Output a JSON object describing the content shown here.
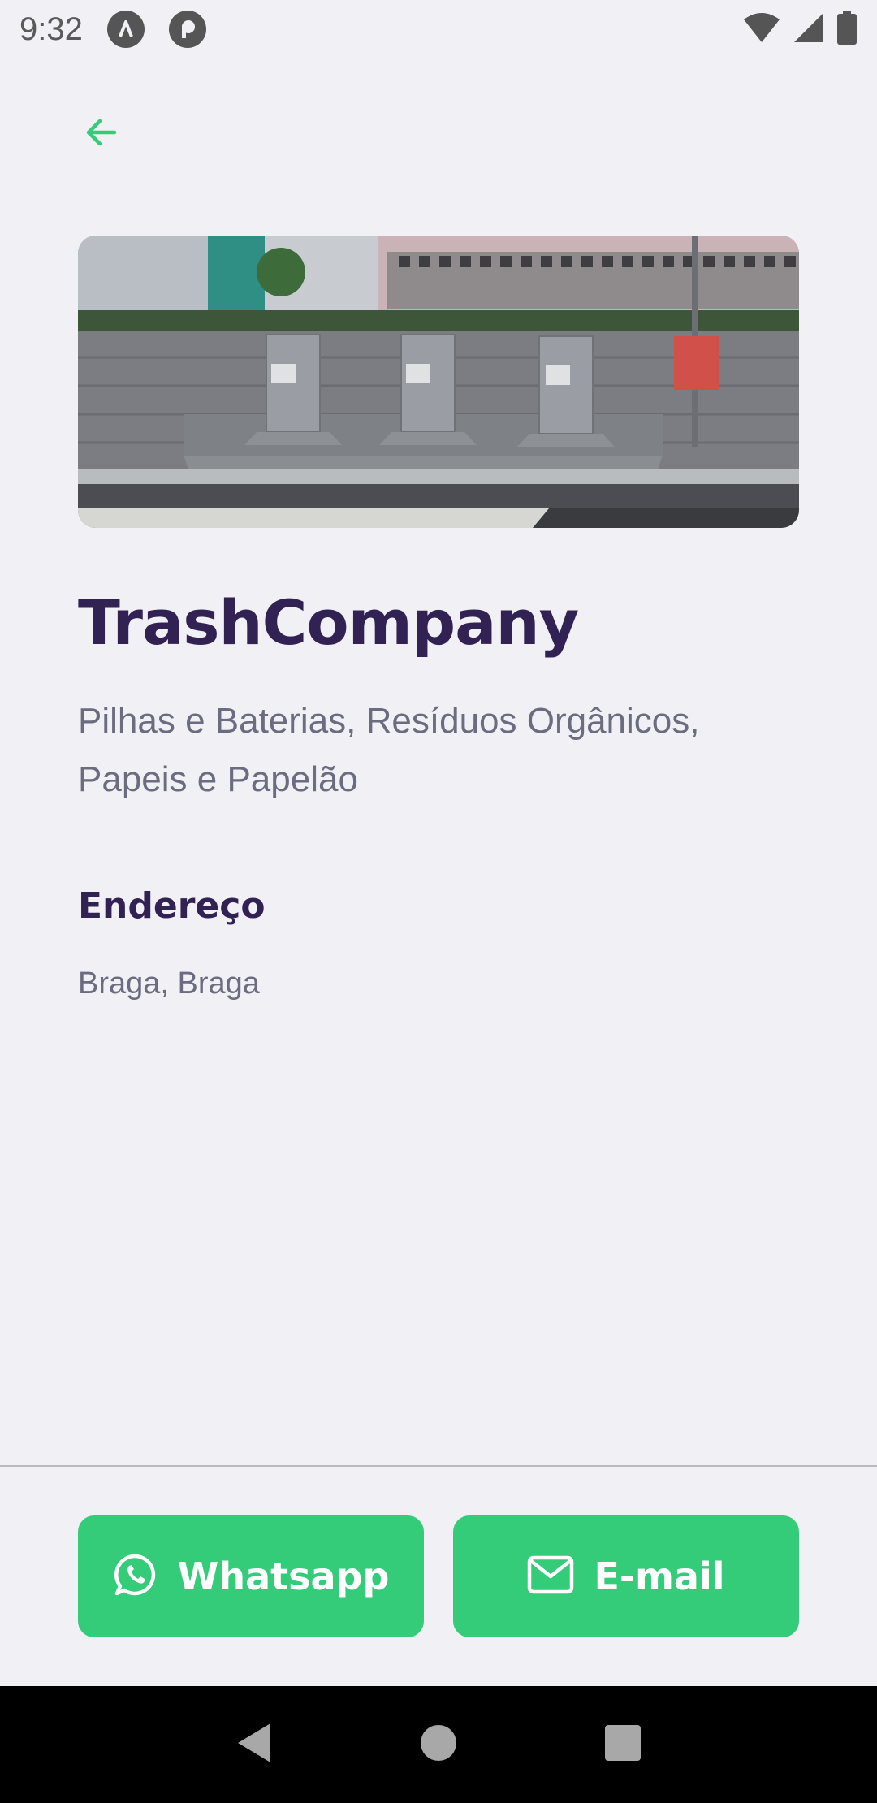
{
  "status_bar": {
    "time": "9:32",
    "icons": [
      "app-notification-icon-a",
      "app-notification-icon-b",
      "wifi-icon",
      "cellular-signal-icon",
      "battery-icon"
    ]
  },
  "header": {
    "back_icon": "arrow-left-icon"
  },
  "point": {
    "name": "TrashCompany",
    "items": "Pilhas e Baterias, Resíduos Orgânicos, Papeis e Papelão",
    "address_title": "Endereço",
    "address": "Braga, Braga"
  },
  "footer": {
    "whatsapp_label": "Whatsapp",
    "whatsapp_icon": "whatsapp-icon",
    "email_label": "E-mail",
    "email_icon": "mail-icon"
  },
  "nav_bar": {
    "icons": [
      "back-icon",
      "home-icon",
      "recents-icon"
    ]
  },
  "colors": {
    "background": "#f0f0f5",
    "accent": "#34cb79",
    "title": "#322153",
    "text": "#6c6c80"
  }
}
